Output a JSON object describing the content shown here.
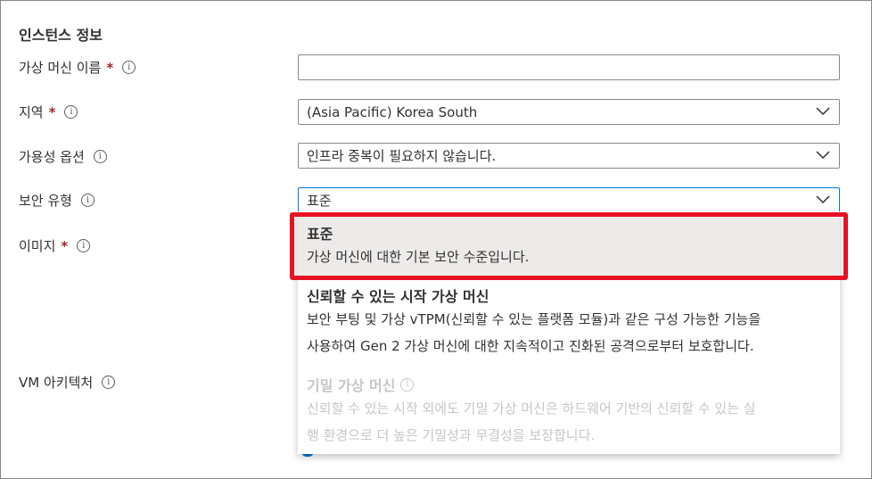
{
  "section": {
    "title": "인스턴스 정보"
  },
  "fields": {
    "vm_name": {
      "label": "가상 머신 이름",
      "required": "*",
      "value": ""
    },
    "region": {
      "label": "지역",
      "required": "*",
      "value": "(Asia Pacific) Korea South"
    },
    "availability": {
      "label": "가용성 옵션",
      "value": "인프라 중복이 필요하지 않습니다."
    },
    "security_type": {
      "label": "보안 유형",
      "value": "표준"
    },
    "image": {
      "label": "이미지",
      "required": "*"
    },
    "vm_architecture": {
      "label": "VM 아키텍처"
    }
  },
  "security_options": [
    {
      "title": "표준",
      "desc": "가상 머신에 대한 기본 보안 수준입니다."
    },
    {
      "title": "신뢰할 수 있는 시작 가상 머신",
      "desc_line1": "보안 부팅 및 가상 vTPM(신뢰할 수 있는 플랫폼 모듈)과 같은 구성 가능한 기능을",
      "desc_line2": "사용하여 Gen 2 가상 머신에 대한 지속적이고 진화된 공격으로부터 보호합니다."
    },
    {
      "title": "기밀 가상 머신",
      "desc_line1": "신뢰할 수 있는 시작 외에도 기밀 가상 머신은 하드웨어 기반의 신뢰할 수 있는 실",
      "desc_line2": "행 환경으로 더 높은 기밀성과 무결성을 보장합니다."
    }
  ],
  "icons": {
    "info": "info-icon",
    "chevron": "chevron-down-icon"
  },
  "info_glyph": "i",
  "colors": {
    "required": "#a4262c",
    "focus": "#0078d4",
    "highlight": "#e81123",
    "selected_bg": "#edebe9"
  }
}
